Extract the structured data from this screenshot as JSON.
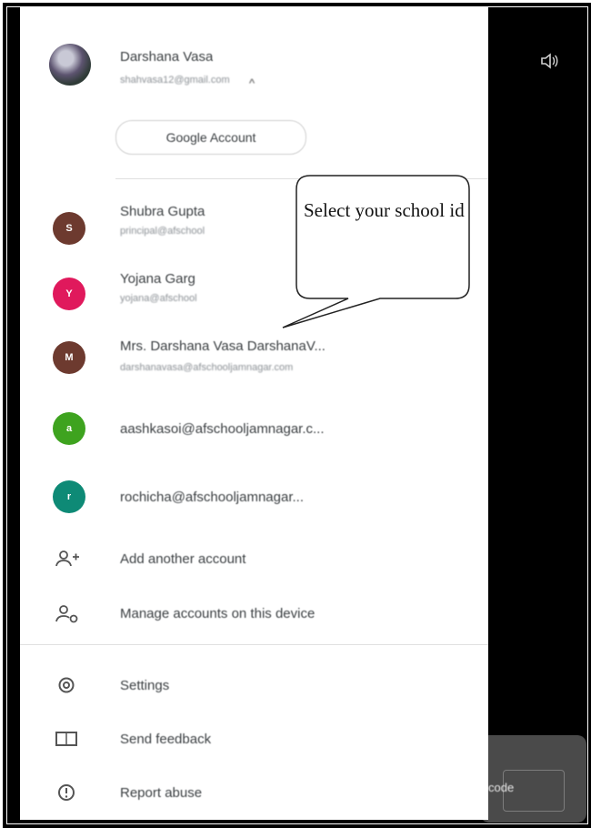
{
  "current_user": {
    "name": "Darshana Vasa",
    "email": "shahvasa12@gmail.com",
    "expand_glyph": "^"
  },
  "google_account_button": "Google Account",
  "accounts": [
    {
      "initial": "S",
      "name": "Shubra Gupta",
      "email": "principal@afschool",
      "color": "#6d3a2f"
    },
    {
      "initial": "Y",
      "name": "Yojana Garg",
      "email": "yojana@afschool",
      "color": "#e0195c"
    },
    {
      "initial": "M",
      "name": "Mrs. Darshana Vasa DarshanaV...",
      "email": "darshanavasa@afschooljamnagar.com",
      "color": "#6d3a2f"
    },
    {
      "initial": "a",
      "name": "aashkasoi@afschooljamnagar.c...",
      "email": "",
      "color": "#3ea31f"
    },
    {
      "initial": "r",
      "name": "rochicha@afschooljamnagar...",
      "email": "",
      "color": "#0e8a76"
    }
  ],
  "account_actions": {
    "add": "Add another account",
    "manage": "Manage accounts on this device"
  },
  "footer_menu": {
    "settings": "Settings",
    "feedback": "Send feedback",
    "report": "Report abuse"
  },
  "callout": "Select your school id",
  "right_panel": {
    "code_label": "code"
  },
  "icons": {
    "speaker": "speaker-icon",
    "add_account": "add-person-icon",
    "manage_accounts": "manage-accounts-icon",
    "settings": "gear-icon",
    "feedback": "feedback-icon",
    "report": "report-icon"
  }
}
